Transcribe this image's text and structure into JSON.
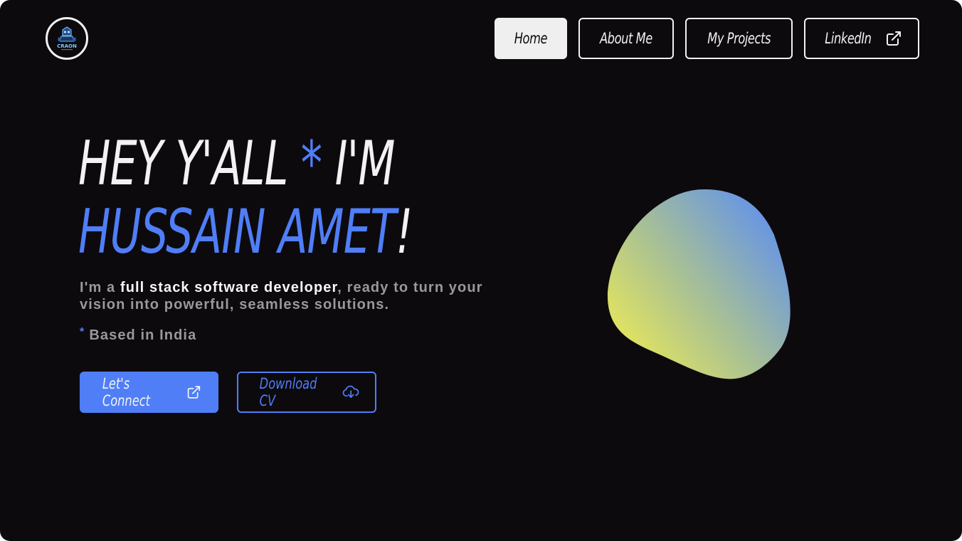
{
  "brand": {
    "logo_icon": "robot-mascot-logo-icon",
    "logo_text": "CRAON"
  },
  "nav": {
    "items": [
      {
        "label": "Home",
        "active": true
      },
      {
        "label": "About Me",
        "active": false
      },
      {
        "label": "My Projects",
        "active": false
      },
      {
        "label": "LinkedIn",
        "active": false,
        "icon": "external-link-icon"
      }
    ]
  },
  "hero": {
    "title_line1_pre": "HEY Y'ALL ",
    "title_star": "*",
    "title_line1_post": " I'M",
    "title_name": "HUSSAIN AMET",
    "title_exclaim": "!",
    "desc_pre": "I'm a ",
    "desc_strong": "full stack software developer",
    "desc_post": ", ready to turn your vision into powerful, seamless solutions.",
    "location_star": "*",
    "location": "Based in India"
  },
  "actions": {
    "connect_label": "Let's Connect",
    "connect_icon": "external-link-icon",
    "cv_label": "Download CV",
    "cv_icon": "cloud-download-icon"
  },
  "colors": {
    "background": "#0d0a0e",
    "accent": "#4f7ef7",
    "text": "#f2f2f2",
    "muted": "#9a979d",
    "blob_gradient_start": "#e8e85a",
    "blob_gradient_end": "#5d8ff0"
  }
}
